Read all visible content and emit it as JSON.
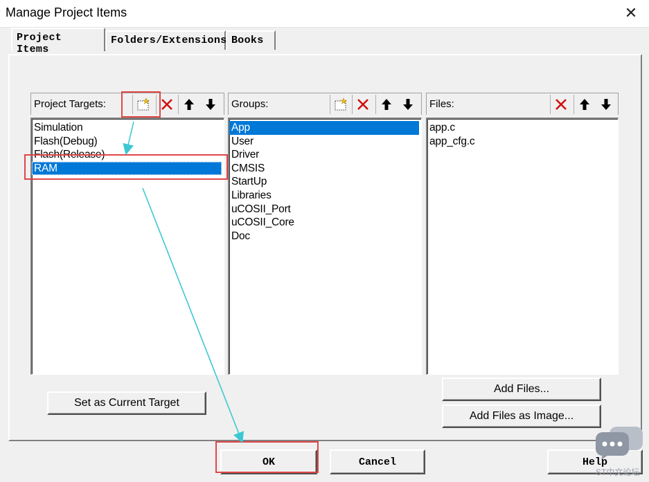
{
  "window": {
    "title": "Manage Project Items",
    "close_glyph": "✕"
  },
  "tabs": [
    {
      "label": "Project Items",
      "active": true
    },
    {
      "label": "Folders/Extensions",
      "active": false
    },
    {
      "label": "Books",
      "active": false
    }
  ],
  "targets": {
    "label": "Project Targets:",
    "items": [
      "Simulation",
      "Flash(Debug)",
      "Flash(Release)",
      "RAM"
    ],
    "selected": "RAM"
  },
  "groups": {
    "label": "Groups:",
    "items": [
      "App",
      "User",
      "Driver",
      "CMSIS",
      "StartUp",
      "Libraries",
      "uCOSII_Port",
      "uCOSII_Core",
      "Doc"
    ],
    "selected": "App"
  },
  "files": {
    "label": "Files:",
    "items": [
      "app.c",
      "app_cfg.c"
    ]
  },
  "buttons": {
    "set_current": "Set as Current Target",
    "add_files": "Add Files...",
    "add_files_image": "Add Files as Image...",
    "ok": "OK",
    "cancel": "Cancel",
    "help": "Help"
  },
  "icons": {
    "new": "new-item-icon",
    "delete": "delete-icon",
    "move_up": "move-up-icon",
    "move_down": "move-down-icon"
  },
  "colors": {
    "selection": "#0078d7",
    "annotation_box": "#e04646",
    "annotation_arrow": "#3cc8d2"
  },
  "watermark": "ST中文论坛"
}
